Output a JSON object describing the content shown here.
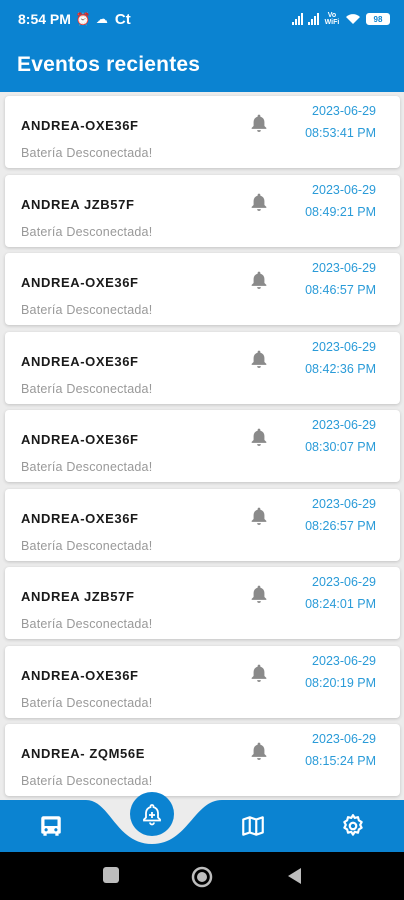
{
  "statusbar": {
    "time": "8:54 PM",
    "carrier": "Ct",
    "network_label": "Vo WiFi",
    "battery": "98"
  },
  "appbar": {
    "title": "Eventos recientes"
  },
  "events": [
    {
      "name": "ANDREA-OXE36F",
      "message": "Batería Desconectada!",
      "date": "2023-06-29",
      "time": "08:53:41 PM"
    },
    {
      "name": "ANDREA JZB57F",
      "message": "Batería Desconectada!",
      "date": "2023-06-29",
      "time": "08:49:21 PM"
    },
    {
      "name": "ANDREA-OXE36F",
      "message": "Batería Desconectada!",
      "date": "2023-06-29",
      "time": "08:46:57 PM"
    },
    {
      "name": "ANDREA-OXE36F",
      "message": "Batería Desconectada!",
      "date": "2023-06-29",
      "time": "08:42:36 PM"
    },
    {
      "name": "ANDREA-OXE36F",
      "message": "Batería Desconectada!",
      "date": "2023-06-29",
      "time": "08:30:07 PM"
    },
    {
      "name": "ANDREA-OXE36F",
      "message": "Batería Desconectada!",
      "date": "2023-06-29",
      "time": "08:26:57 PM"
    },
    {
      "name": "ANDREA JZB57F",
      "message": "Batería Desconectada!",
      "date": "2023-06-29",
      "time": "08:24:01 PM"
    },
    {
      "name": "ANDREA-OXE36F",
      "message": "Batería Desconectada!",
      "date": "2023-06-29",
      "time": "08:20:19 PM"
    },
    {
      "name": "ANDREA- ZQM56E",
      "message": "Batería Desconectada!",
      "date": "2023-06-29",
      "time": "08:15:24 PM"
    }
  ],
  "bottomnav": {
    "items": [
      {
        "icon": "bus-icon"
      },
      {
        "icon": "bell-plus-icon",
        "active": true
      },
      {
        "icon": "map-icon"
      },
      {
        "icon": "gear-icon"
      }
    ]
  },
  "colors": {
    "primary": "#0b83d1",
    "accent": "#2a9bd8"
  }
}
